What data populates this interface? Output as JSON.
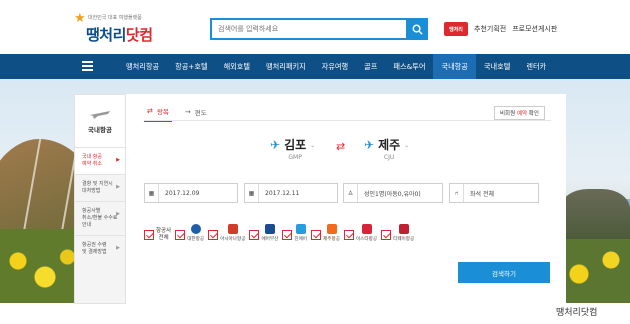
{
  "brand": {
    "tagline": "대한민국 대표 여행플랫폼",
    "name_part1": "땡처리",
    "name_part2": "닷컴"
  },
  "search": {
    "placeholder": "검색어를 입력하세요",
    "icon": "search-icon"
  },
  "top_links": {
    "mini_logo": "땡처리",
    "recommend": "추천기획전",
    "promo": "프로모션게시판"
  },
  "nav": {
    "items": [
      "땡처리항공",
      "항공+호텔",
      "해외호텔",
      "땡처리패키지",
      "자유여행",
      "골프",
      "패스&투어",
      "국내항공",
      "국내호텔",
      "렌터카"
    ],
    "active_index": 7
  },
  "sidebar": {
    "title": "국내항공",
    "items": [
      {
        "line1": "국내 항공",
        "line2": "예약 취소"
      },
      {
        "line1": "결항 및 지연시",
        "line2": "대처방법"
      },
      {
        "line1": "항공사별",
        "line2": "취소/환불 수수료안내"
      },
      {
        "line1": "항공권 수령",
        "line2": "및 결제방법"
      }
    ]
  },
  "booking": {
    "trip_types": [
      "왕복",
      "편도"
    ],
    "active_trip": 0,
    "member_check_prefix": "비회원 ",
    "member_check_red": "예약",
    "member_check_suffix": " 확인",
    "origin": {
      "name": "김포",
      "code": "GMP"
    },
    "destination": {
      "name": "제주",
      "code": "CJU"
    },
    "depart_date": "2017.12.09",
    "return_date": "2017.12.11",
    "passengers": "성인1명(아동0,유아0)",
    "seat_class": "좌석 전체",
    "airlines_all": [
      "항공사",
      "전체"
    ],
    "airlines": [
      {
        "name": "대한항공",
        "color": "#1f5ea8"
      },
      {
        "name": "아시아나항공",
        "color": "#d23a2a"
      },
      {
        "name": "에어부산",
        "color": "#1b4c8f"
      },
      {
        "name": "진에어",
        "color": "#2c9adf"
      },
      {
        "name": "제주항공",
        "color": "#f26a1b"
      },
      {
        "name": "이스타항공",
        "color": "#d6253a"
      },
      {
        "name": "티웨이항공",
        "color": "#c0202f"
      }
    ],
    "search_label": "검색하기"
  },
  "caption": "땡처리닷컴"
}
